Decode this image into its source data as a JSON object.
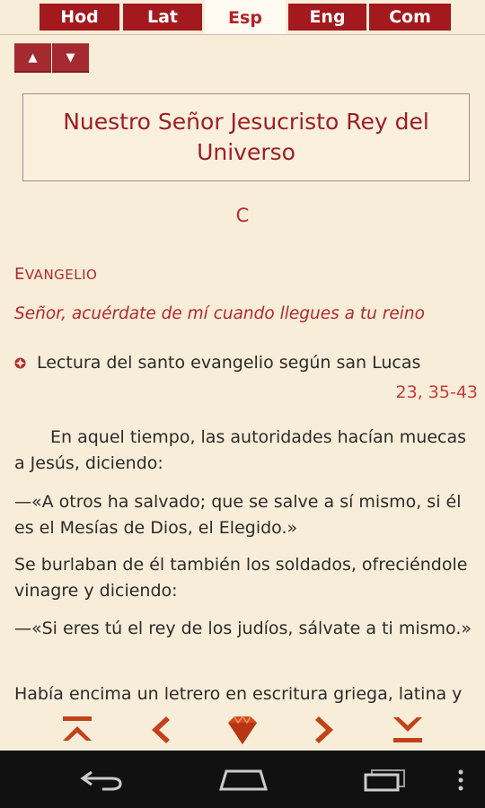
{
  "tabs": [
    "Hod",
    "Lat",
    "Esp",
    "Eng",
    "Com"
  ],
  "active_tab": "Esp",
  "arrows": {
    "up": "▲",
    "down": "▼"
  },
  "title": "Nuestro Señor Jesucristo Rey del Universo",
  "cycle": "C",
  "section_initial": "E",
  "section_rest": "VANGELIO",
  "antiphon": "Señor, acuérdate de mí cuando llegues a tu reino",
  "reading_title": "Lectura del santo evangelio según san Lucas",
  "reading_ref": "23, 35-43",
  "paragraphs": [
    "En aquel tiempo, las autoridades hacían muecas a Jesús, diciendo:",
    "—«A otros ha salvado; que se salve a sí mismo, si él es el Mesías de Dios, el Elegido.»",
    "Se burlaban de él también los soldados, ofreciéndole vinagre y diciendo:",
    "—«Si eres tú el rey de los judíos, sálvate a ti mismo.»",
    "Había encima un letrero en escritura griega, latina y"
  ],
  "colors": {
    "accent": "#a3191d",
    "text_red": "#b02a2e",
    "background": "#f8edd8"
  },
  "icons": [
    "first-page-icon",
    "previous-icon",
    "gem-icon",
    "next-icon",
    "last-page-icon",
    "back-icon",
    "home-icon",
    "recents-icon",
    "overflow-menu-icon"
  ]
}
